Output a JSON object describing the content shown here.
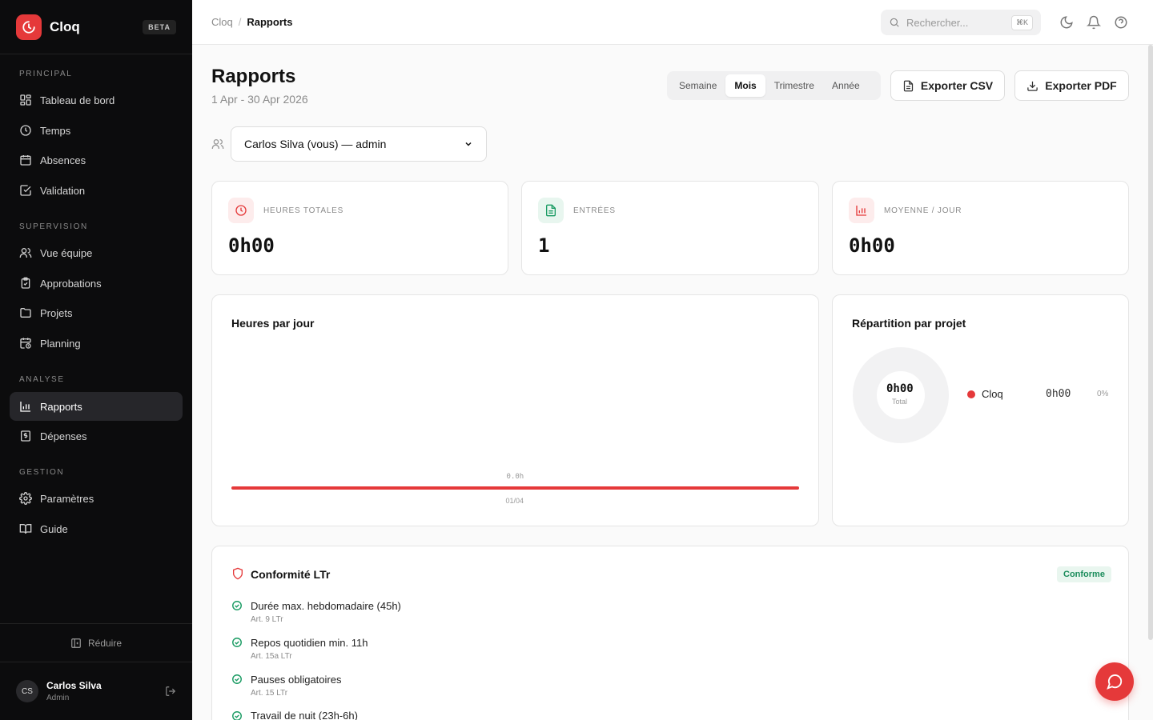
{
  "app": {
    "name": "Cloq",
    "badge": "BETA"
  },
  "sidebar": {
    "sections": [
      {
        "title": "PRINCIPAL",
        "items": [
          {
            "label": "Tableau de bord",
            "icon": "dashboard-icon"
          },
          {
            "label": "Temps",
            "icon": "clock-icon"
          },
          {
            "label": "Absences",
            "icon": "calendar-icon"
          },
          {
            "label": "Validation",
            "icon": "check-square-icon"
          }
        ]
      },
      {
        "title": "SUPERVISION",
        "items": [
          {
            "label": "Vue équipe",
            "icon": "users-icon"
          },
          {
            "label": "Approbations",
            "icon": "clipboard-check-icon"
          },
          {
            "label": "Projets",
            "icon": "folder-icon"
          },
          {
            "label": "Planning",
            "icon": "calendar-clock-icon"
          }
        ]
      },
      {
        "title": "ANALYSE",
        "items": [
          {
            "label": "Rapports",
            "icon": "bar-chart-icon",
            "active": true
          },
          {
            "label": "Dépenses",
            "icon": "receipt-icon"
          }
        ]
      },
      {
        "title": "GESTION",
        "items": [
          {
            "label": "Paramètres",
            "icon": "gear-icon"
          },
          {
            "label": "Guide",
            "icon": "book-icon"
          }
        ]
      }
    ],
    "collapse_label": "Réduire",
    "user": {
      "initials": "CS",
      "name": "Carlos Silva",
      "role": "Admin"
    }
  },
  "topbar": {
    "breadcrumb": {
      "root": "Cloq",
      "separator": "/",
      "current": "Rapports"
    },
    "search": {
      "placeholder": "Rechercher...",
      "shortcut": "⌘K"
    }
  },
  "page": {
    "title": "Rapports",
    "subtitle": "1 Apr - 30 Apr 2026",
    "periods": [
      "Semaine",
      "Mois",
      "Trimestre",
      "Année"
    ],
    "active_period": "Mois",
    "export_csv": "Exporter CSV",
    "export_pdf": "Exporter PDF",
    "user_select": "Carlos Silva (vous) — admin"
  },
  "stats": [
    {
      "label": "HEURES TOTALES",
      "value": "0h00",
      "icon": "clock-icon",
      "color": "#e5393a"
    },
    {
      "label": "ENTRÉES",
      "value": "1",
      "icon": "file-text-icon",
      "color": "#1a9b63"
    },
    {
      "label": "MOYENNE / JOUR",
      "value": "0h00",
      "icon": "bar-chart-icon",
      "color": "#e5393a"
    }
  ],
  "hours_chart": {
    "title": "Heures par jour",
    "chart_data": {
      "type": "bar",
      "categories": [
        "01/04"
      ],
      "values": [
        0.0
      ],
      "value_labels": [
        "0.0h"
      ],
      "title": "Heures par jour",
      "xlabel": "",
      "ylabel": ""
    }
  },
  "project_chart": {
    "title": "Répartition par projet",
    "total_value": "0h00",
    "total_label": "Total",
    "chart_data": {
      "type": "pie",
      "categories": [
        "Cloq"
      ],
      "values": [
        0
      ],
      "title": "Répartition par projet"
    },
    "legend": [
      {
        "name": "Cloq",
        "hours": "0h00",
        "percent": "0%",
        "color": "#e5393a"
      }
    ]
  },
  "compliance": {
    "title": "Conformité LTr",
    "status": "Conforme",
    "rules": [
      {
        "title": "Durée max. hebdomadaire (45h)",
        "ref": "Art. 9 LTr"
      },
      {
        "title": "Repos quotidien min. 11h",
        "ref": "Art. 15a LTr"
      },
      {
        "title": "Pauses obligatoires",
        "ref": "Art. 15 LTr"
      },
      {
        "title": "Travail de nuit (23h-6h)",
        "ref": ""
      }
    ]
  },
  "colors": {
    "accent": "#e5393a",
    "success": "#1a8c5b",
    "sidebar_bg": "#0c0c0d"
  }
}
